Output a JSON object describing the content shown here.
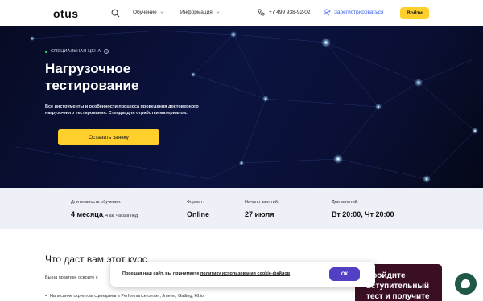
{
  "header": {
    "logo": "otus",
    "nav": [
      {
        "label": "Обучение"
      },
      {
        "label": "Информация"
      }
    ],
    "phone": "+7 499 938-92-02",
    "register_label": "Зарегистрироваться",
    "login_label": "Войти"
  },
  "hero": {
    "badge": "СПЕЦИАЛЬНАЯ ЦЕНА",
    "title": "Нагрузочное тестирование",
    "description": "Все инструменты и особенности процесса проведения достоверного нагрузочного тестирования. Стенды для отработки материалов.",
    "cta_label": "Оставить заявку"
  },
  "info": {
    "duration_label": "Длительность обучения:",
    "duration_value": "4 месяца",
    "duration_note": "4 ак. часа в нед.",
    "format_label": "Формат:",
    "format_value": "Online",
    "start_label": "Начало занятий:",
    "start_value": "27 июля",
    "days_label": "Дни занятий:",
    "days_value": "Вт 20:00, Чт 20:00"
  },
  "content": {
    "title": "Что даст вам этот курс",
    "paragraph": "Вы на практике освоите с",
    "bullet": "Написание скриптов/ сценариев в Performance center, Jmeter, Gatling, k6.io"
  },
  "promo": {
    "text": "Пройдите вступительный тест и получите"
  },
  "cookie": {
    "text_before": "Посещая наш сайт, вы принимаете ",
    "link": "политику использования cookie-файлов",
    "ok_label": "ОК"
  },
  "colors": {
    "accent_yellow": "#ffd02b",
    "link_blue": "#3c63e8",
    "cookie_button": "#5140c4",
    "hero_bg": "#0b1340",
    "chat_button": "#1f5848"
  }
}
